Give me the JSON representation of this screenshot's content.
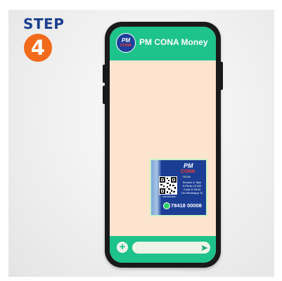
{
  "step": {
    "label": "STEP",
    "number": "4"
  },
  "chat": {
    "contact_name": "PM CONA Money",
    "avatar_logo": "PM CONA"
  },
  "message_image": {
    "logo_pm": "PM",
    "logo_cona": "CONA",
    "partner_brand": "T4E.life",
    "qr_caption": "7/8418000008",
    "instructions": [
      "Scratch & Take",
      "A Photo Of QR",
      "Code & Send",
      "On WhatsApp To"
    ],
    "whatsapp_number": "78418 00008",
    "whatsapp_icon": "whatsapp-icon"
  },
  "input_bar": {
    "attach_label": "+",
    "text_value": "",
    "send_icon": "send-icon"
  },
  "colors": {
    "step_text": "#1a3f8f",
    "step_badge": "#f26a1b",
    "header_green": "#1ec28b",
    "chat_background": "#fde4cf",
    "card_blue": "#1b3d94"
  }
}
